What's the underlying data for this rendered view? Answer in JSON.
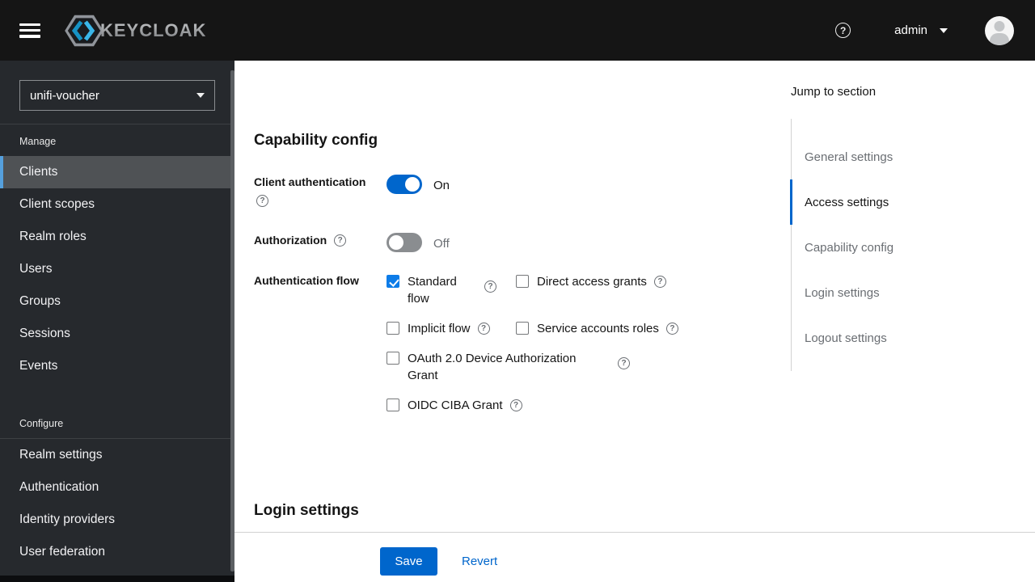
{
  "header": {
    "brand_text": "KEYCLOAK",
    "user_menu": {
      "username": "admin"
    }
  },
  "sidebar": {
    "realm_selector": {
      "value": "unifi-voucher"
    },
    "sections": [
      {
        "title": "Manage",
        "items": [
          {
            "label": "Clients",
            "selected": true
          },
          {
            "label": "Client scopes",
            "selected": false
          },
          {
            "label": "Realm roles",
            "selected": false
          },
          {
            "label": "Users",
            "selected": false
          },
          {
            "label": "Groups",
            "selected": false
          },
          {
            "label": "Sessions",
            "selected": false
          },
          {
            "label": "Events",
            "selected": false
          }
        ]
      },
      {
        "title": "Configure",
        "items": [
          {
            "label": "Realm settings",
            "selected": false
          },
          {
            "label": "Authentication",
            "selected": false
          },
          {
            "label": "Identity providers",
            "selected": false
          },
          {
            "label": "User federation",
            "selected": false
          }
        ]
      }
    ]
  },
  "capability": {
    "heading": "Capability config",
    "client_authentication": {
      "label": "Client authentication",
      "value": "On",
      "enabled": true
    },
    "authorization": {
      "label": "Authorization",
      "value": "Off",
      "enabled": false
    },
    "authentication_flow": {
      "label": "Authentication flow",
      "options": [
        {
          "label": "Standard flow",
          "checked": true
        },
        {
          "label": "Direct access grants",
          "checked": false
        },
        {
          "label": "Implicit flow",
          "checked": false
        },
        {
          "label": "Service accounts roles",
          "checked": false
        },
        {
          "label": "OAuth 2.0 Device Authorization Grant",
          "checked": false
        },
        {
          "label": "OIDC CIBA Grant",
          "checked": false
        }
      ]
    }
  },
  "login_settings": {
    "heading": "Login settings"
  },
  "actions": {
    "save_label": "Save",
    "revert_label": "Revert"
  },
  "jump_to_section": {
    "title": "Jump to section",
    "items": [
      {
        "label": "General settings",
        "active": false
      },
      {
        "label": "Access settings",
        "active": true
      },
      {
        "label": "Capability config",
        "active": false
      },
      {
        "label": "Login settings",
        "active": false
      },
      {
        "label": "Logout settings",
        "active": false
      }
    ]
  },
  "colors": {
    "primary": "#0066cc",
    "checkbox_checked": "#0d7ce8",
    "header_bg": "#151515",
    "sidebar_bg": "#26292d",
    "nav_selected_bg": "#4f5255",
    "nav_selected_border": "#55a0dd",
    "muted_text": "#6a6e73",
    "divider": "#d2d2d2"
  }
}
